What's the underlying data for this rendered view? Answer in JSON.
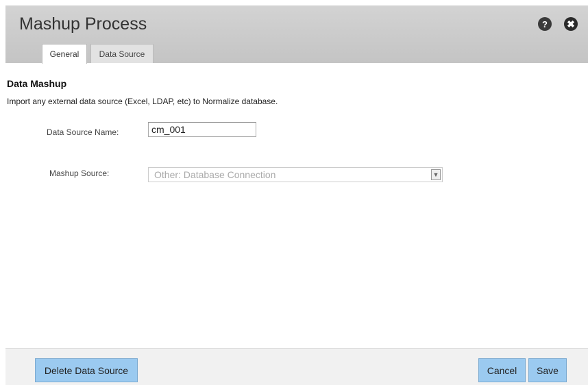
{
  "dialog": {
    "title": "Mashup Process",
    "help_glyph": "?",
    "close_glyph": "✖",
    "tabs": [
      {
        "label": "General"
      },
      {
        "label": "Data Source"
      }
    ]
  },
  "section": {
    "title": "Data Mashup",
    "description": "Import any external data source (Excel, LDAP, etc) to Normalize database."
  },
  "form": {
    "name_label": "Data Source Name:",
    "name_value": "cm_001",
    "source_label": "Mashup Source:",
    "source_value": "Other: Database Connection"
  },
  "footer": {
    "delete_label": "Delete Data Source",
    "cancel_label": "Cancel",
    "save_label": "Save"
  },
  "colors": {
    "header_bg": "#c9c9c9",
    "button_bg": "#9bcaf0",
    "footer_bg": "#f1f1f1"
  },
  "icons": {
    "help": "help-icon",
    "close": "close-icon",
    "dropdown": "chevron-down-icon"
  }
}
